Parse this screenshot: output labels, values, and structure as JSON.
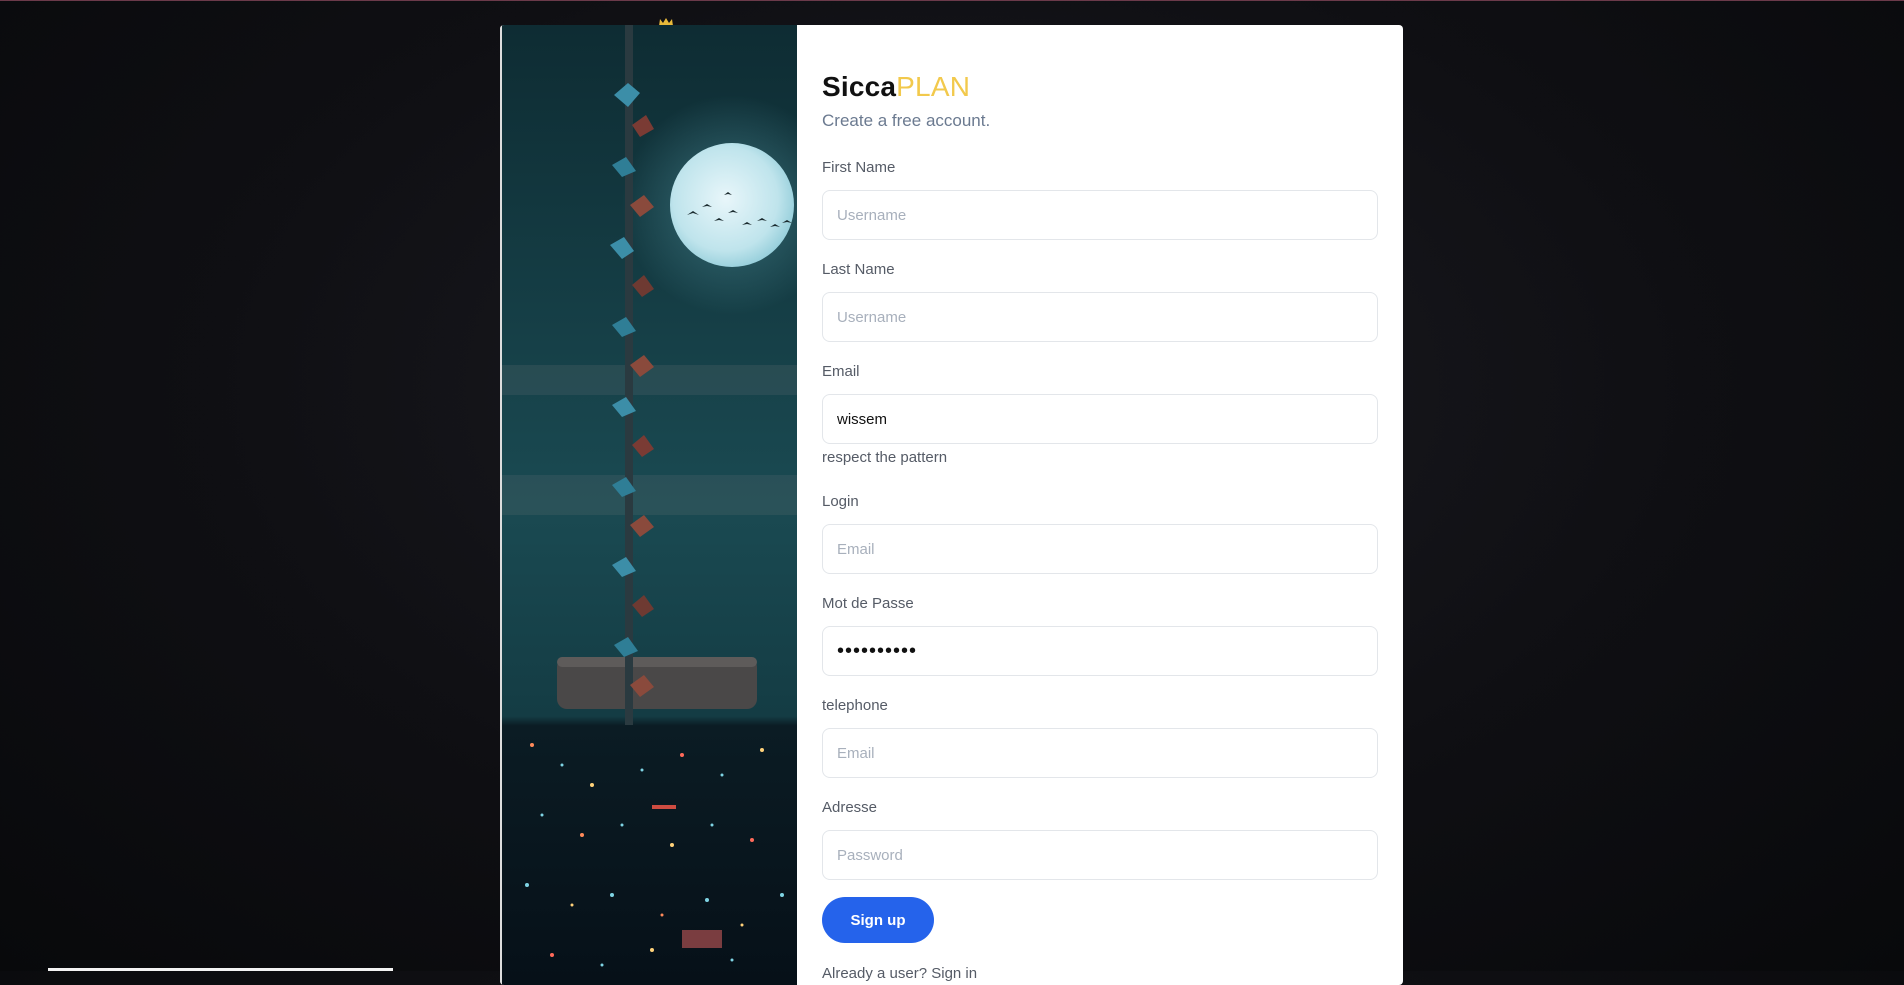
{
  "brand": {
    "name_main": "Sicca",
    "name_accent": "PLAN",
    "accent_color": "#f2c94c"
  },
  "subtitle": "Create a free account.",
  "fields": {
    "first_name": {
      "label": "First Name",
      "placeholder": "Username",
      "value": ""
    },
    "last_name": {
      "label": "Last Name",
      "placeholder": "Username",
      "value": ""
    },
    "email": {
      "label": "Email",
      "placeholder": "",
      "value": "wissem",
      "hint": "respect the pattern"
    },
    "login": {
      "label": "Login",
      "placeholder": "Email",
      "value": ""
    },
    "password": {
      "label": "Mot de Passe",
      "placeholder": "",
      "value": "••••••••••"
    },
    "telephone": {
      "label": "telephone",
      "placeholder": "Email",
      "value": ""
    },
    "address": {
      "label": "Adresse",
      "placeholder": "Password",
      "value": ""
    }
  },
  "signup_button": {
    "label": "Sign up",
    "color": "#2563eb"
  },
  "signin_prompt": "Already a user? Sign in",
  "icons": {
    "crown": "crown-icon"
  }
}
